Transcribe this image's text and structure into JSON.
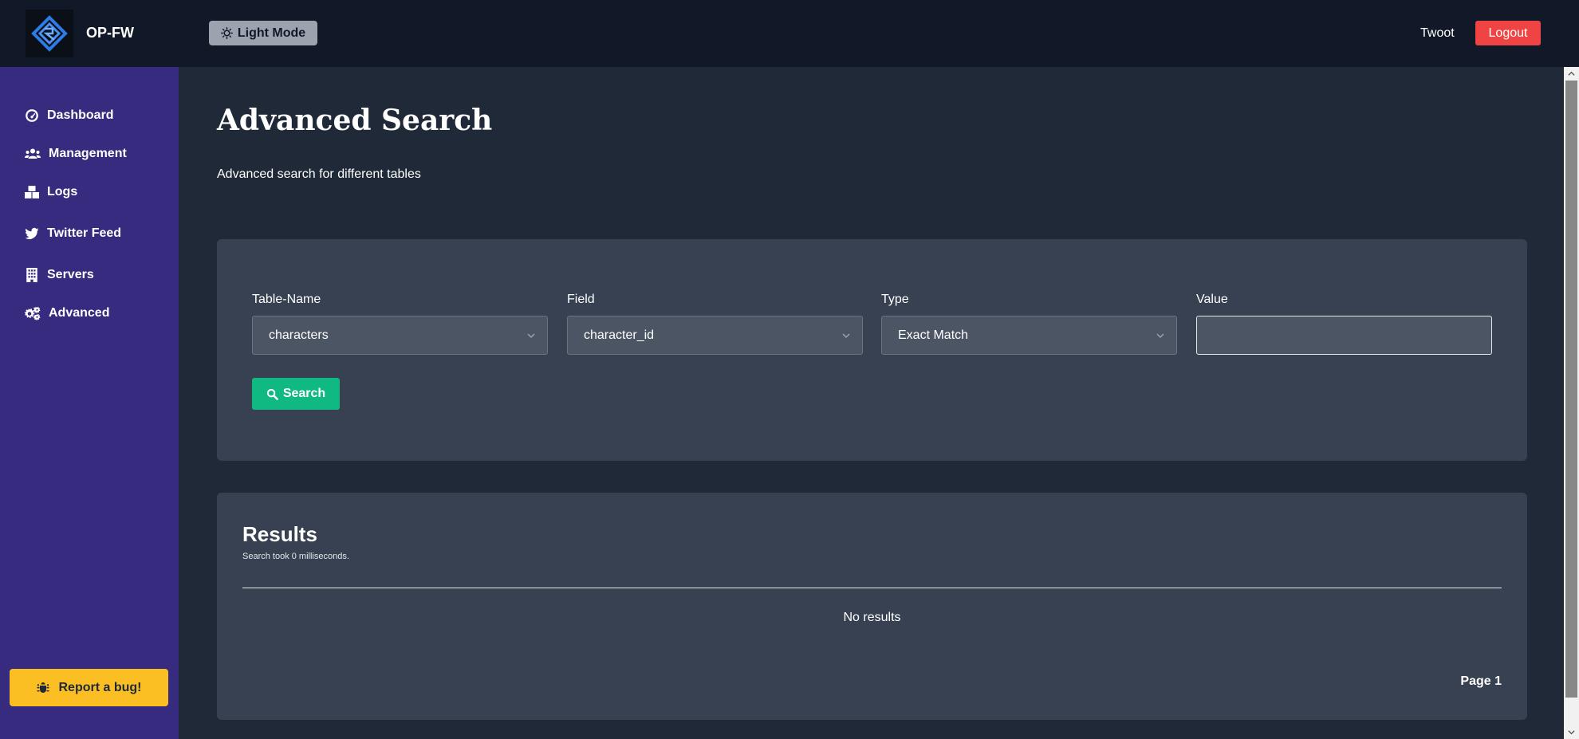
{
  "header": {
    "brand": "OP-FW",
    "theme_toggle_label": "Light Mode",
    "username": "Twoot",
    "logout_label": "Logout"
  },
  "sidebar": {
    "items": [
      {
        "label": "Dashboard",
        "icon": "dashboard-icon"
      },
      {
        "label": "Management",
        "icon": "users-icon"
      },
      {
        "label": "Logs",
        "icon": "boxes-icon"
      },
      {
        "label": "Twitter Feed",
        "icon": "twitter-icon"
      },
      {
        "label": "Servers",
        "icon": "building-icon"
      },
      {
        "label": "Advanced",
        "icon": "cogs-icon"
      }
    ],
    "bug_report_label": "Report a bug!"
  },
  "page": {
    "title": "Advanced Search",
    "subtitle": "Advanced search for different tables"
  },
  "search_form": {
    "table_label": "Table-Name",
    "table_value": "characters",
    "field_label": "Field",
    "field_value": "character_id",
    "type_label": "Type",
    "type_value": "Exact Match",
    "value_label": "Value",
    "value_value": "",
    "search_label": "Search"
  },
  "results": {
    "title": "Results",
    "timing": "Search took 0 milliseconds.",
    "empty_message": "No results",
    "page_label": "Page 1"
  },
  "colors": {
    "topbar": "#111827",
    "sidebar": "#372b80",
    "main_bg": "#1f2937",
    "card_bg": "#374151",
    "logout": "#ef4444",
    "search_button": "#10b981",
    "bug_button": "#fbbf24"
  }
}
